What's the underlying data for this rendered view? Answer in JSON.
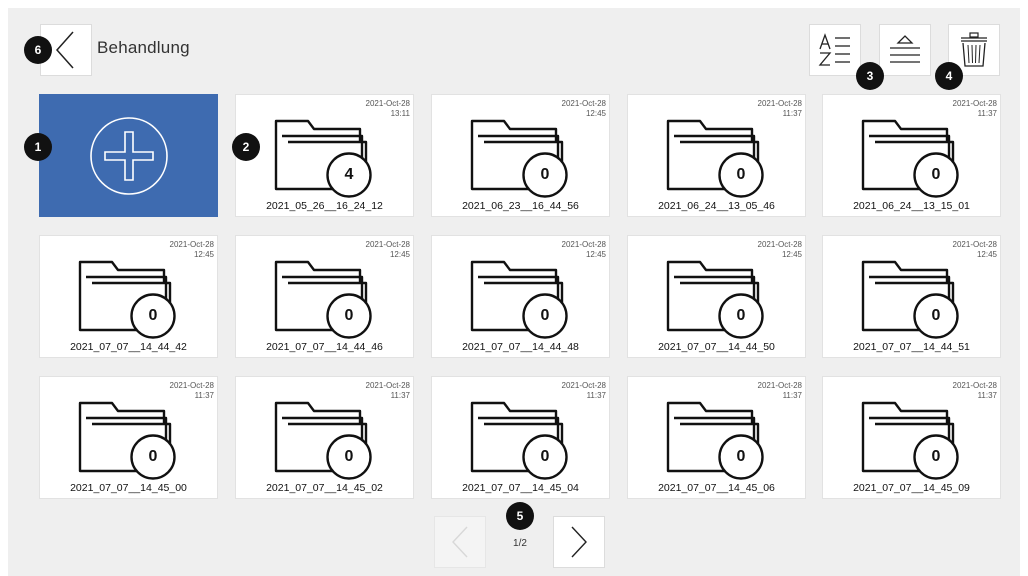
{
  "header": {
    "title": "Behandlung",
    "back_icon": "chevron-left-icon",
    "sort_icon": "sort-alpha-icon",
    "eject_icon": "eject-list-icon",
    "delete_icon": "trash-icon"
  },
  "badges": [
    "1",
    "2",
    "3",
    "4",
    "5",
    "6"
  ],
  "add_tile": {
    "icon": "plus-circle-icon",
    "color": "#3e6bb0"
  },
  "folders": [
    {
      "date": "2021-Oct-28",
      "time": "13:11",
      "count": "4",
      "name": "2021_05_26__16_24_12"
    },
    {
      "date": "2021-Oct-28",
      "time": "12:45",
      "count": "0",
      "name": "2021_06_23__16_44_56"
    },
    {
      "date": "2021-Oct-28",
      "time": "11:37",
      "count": "0",
      "name": "2021_06_24__13_05_46"
    },
    {
      "date": "2021-Oct-28",
      "time": "11:37",
      "count": "0",
      "name": "2021_06_24__13_15_01"
    },
    {
      "date": "2021-Oct-28",
      "time": "12:45",
      "count": "0",
      "name": "2021_07_07__14_44_42"
    },
    {
      "date": "2021-Oct-28",
      "time": "12:45",
      "count": "0",
      "name": "2021_07_07__14_44_46"
    },
    {
      "date": "2021-Oct-28",
      "time": "12:45",
      "count": "0",
      "name": "2021_07_07__14_44_48"
    },
    {
      "date": "2021-Oct-28",
      "time": "12:45",
      "count": "0",
      "name": "2021_07_07__14_44_50"
    },
    {
      "date": "2021-Oct-28",
      "time": "12:45",
      "count": "0",
      "name": "2021_07_07__14_44_51"
    },
    {
      "date": "2021-Oct-28",
      "time": "11:37",
      "count": "0",
      "name": "2021_07_07__14_45_00"
    },
    {
      "date": "2021-Oct-28",
      "time": "11:37",
      "count": "0",
      "name": "2021_07_07__14_45_02"
    },
    {
      "date": "2021-Oct-28",
      "time": "11:37",
      "count": "0",
      "name": "2021_07_07__14_45_04"
    },
    {
      "date": "2021-Oct-28",
      "time": "11:37",
      "count": "0",
      "name": "2021_07_07__14_45_06"
    },
    {
      "date": "2021-Oct-28",
      "time": "11:37",
      "count": "0",
      "name": "2021_07_07__14_45_09"
    }
  ],
  "pager": {
    "page_indicator": "1/2",
    "prev_icon": "chevron-left-icon",
    "next_icon": "chevron-right-icon"
  }
}
